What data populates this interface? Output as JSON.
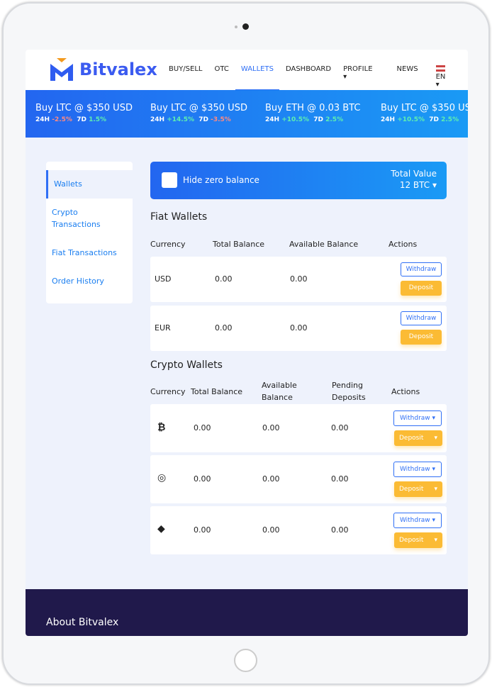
{
  "brand": {
    "name": "Bitvalex"
  },
  "nav": {
    "items": [
      "BUY/SELL",
      "OTC",
      "WALLETS",
      "DASHBOARD",
      "PROFILE",
      "NEWS"
    ],
    "active": "WALLETS",
    "language": "EN"
  },
  "ticker": [
    {
      "title": "Buy LTC @ $350 USD",
      "h24": "-2.5%",
      "d7": "1.5%"
    },
    {
      "title": "Buy LTC @ $350 USD",
      "h24": "+14.5%",
      "d7": "-3.5%"
    },
    {
      "title": "Buy ETH @ 0.03 BTC",
      "h24": "+10.5%",
      "d7": "2.5%"
    },
    {
      "title": "Buy LTC @ $350 USD",
      "h24": "+10.5%",
      "d7": "2.5%"
    }
  ],
  "ticker_labels": {
    "h24": "24H",
    "d7": "7D"
  },
  "sidebar": {
    "items": [
      "Wallets",
      "Crypto Transactions",
      "Fiat Transactions",
      "Order History"
    ],
    "active": "Wallets"
  },
  "filter": {
    "hide_zero_label": "Hide zero balance",
    "total_label": "Total Value",
    "total_value": "12 BTC"
  },
  "fiat": {
    "title": "Fiat Wallets",
    "headers": [
      "Currency",
      "Total Balance",
      "Available Balance",
      "Actions"
    ],
    "rows": [
      {
        "currency": "USD",
        "total": "0.00",
        "available": "0.00"
      },
      {
        "currency": "EUR",
        "total": "0.00",
        "available": "0.00"
      }
    ]
  },
  "crypto": {
    "title": "Crypto Wallets",
    "headers": [
      "Currency",
      "Total Balance",
      "Available Balance",
      "Pending Deposits",
      "Actions"
    ],
    "rows": [
      {
        "icon": "bitcoin-icon",
        "glyph": "₿",
        "total": "0.00",
        "available": "0.00",
        "pending": "0.00"
      },
      {
        "icon": "coin-icon",
        "glyph": "◎",
        "total": "0.00",
        "available": "0.00",
        "pending": "0.00"
      },
      {
        "icon": "ethereum-icon",
        "glyph": "◆",
        "total": "0.00",
        "available": "0.00",
        "pending": "0.00"
      }
    ]
  },
  "actions": {
    "withdraw": "Withdraw",
    "deposit": "Deposit"
  },
  "footer": {
    "title": "About Bitvalex"
  },
  "colors": {
    "accent": "#2f6ff5",
    "deposit": "#fbbb34",
    "footer": "#20194b"
  }
}
